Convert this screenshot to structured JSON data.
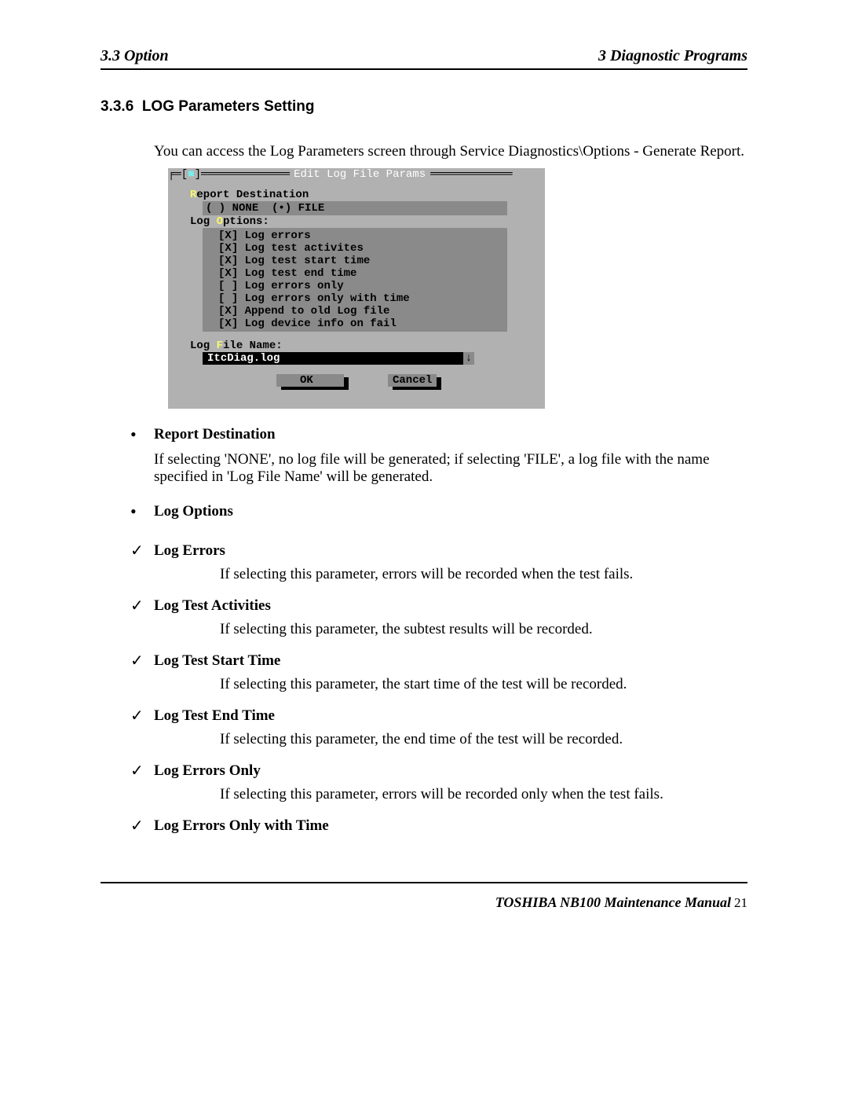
{
  "header": {
    "left": "3.3 Option",
    "right": "3  Diagnostic Programs"
  },
  "section": {
    "number": "3.3.6",
    "title": "LOG Parameters Setting",
    "intro": "You can access the Log Parameters screen through Service Diagnostics\\Options - Generate Report."
  },
  "dos": {
    "title": "Edit Log File Params",
    "report_label": "Report Destination",
    "report_none": "NONE",
    "report_file": "FILE",
    "logopt_label": "Log Options:",
    "options": [
      {
        "mark": "X",
        "text": "Log errors"
      },
      {
        "mark": "X",
        "text": "Log test activites"
      },
      {
        "mark": "X",
        "text": "Log test start time"
      },
      {
        "mark": "X",
        "text": "Log test end time"
      },
      {
        "mark": " ",
        "text": "Log errors only"
      },
      {
        "mark": " ",
        "text": "Log errors only with time"
      },
      {
        "mark": "X",
        "text": "Append to old Log file"
      },
      {
        "mark": "X",
        "text": "Log device info on fail"
      }
    ],
    "logfile_label": "Log File Name:",
    "logfile_value": "ItcDiag.log",
    "ok": "OK",
    "cancel": "Cancel"
  },
  "body": {
    "report_dest_title": "Report Destination",
    "report_dest_desc": "If  selecting 'NONE', no log file will be generated; if selecting 'FILE', a log file with the name specified in 'Log File Name' will be generated.",
    "log_options_title": "Log Options",
    "subs": [
      {
        "title": "Log Errors",
        "desc": "If selecting this parameter, errors will be recorded when the test fails."
      },
      {
        "title": "Log Test Activities",
        "desc": "If selecting this parameter, the subtest results will be recorded."
      },
      {
        "title": "Log Test Start Time",
        "desc": "If selecting this parameter, the start time of the test will be recorded."
      },
      {
        "title": "Log Test End Time",
        "desc": "If selecting this parameter, the end time of the test will be recorded."
      },
      {
        "title": "Log Errors Only",
        "desc": "If selecting this parameter, errors will be recorded only when the test fails."
      },
      {
        "title": "Log Errors Only with Time",
        "desc": ""
      }
    ]
  },
  "footer": {
    "manual": "TOSHIBA NB100 Maintenance Manual",
    "page": "21"
  }
}
